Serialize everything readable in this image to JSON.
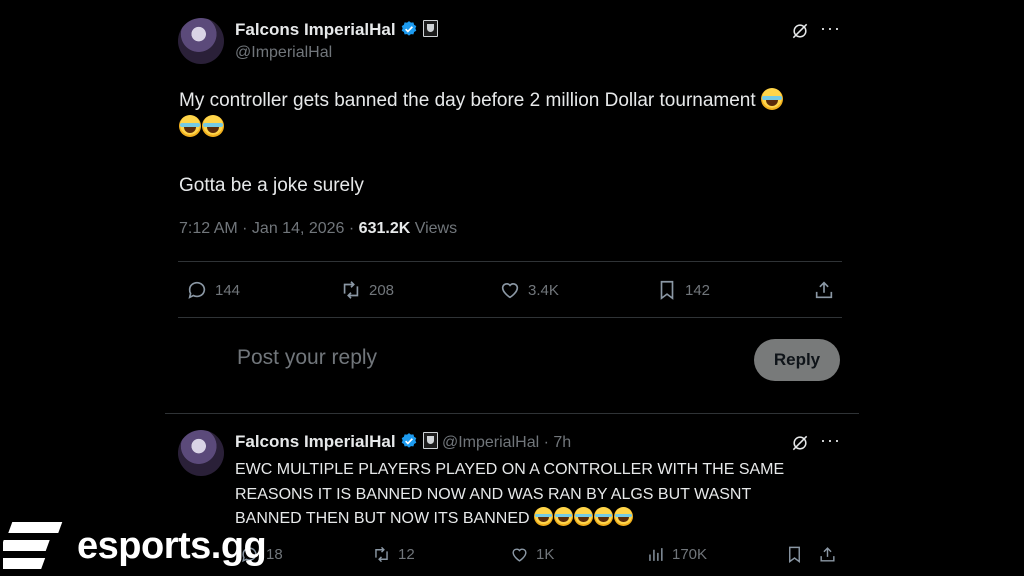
{
  "tweet": {
    "display_name": "Falcons ImperialHal",
    "handle": "@ImperialHal",
    "text_line1": "My controller gets banned the day before 2 million Dollar tournament",
    "text_line2": "Gotta be a joke surely",
    "timestamp": "7:12 AM · Jan 14, 2026 ·",
    "views_count": "631.2K",
    "views_label": "Views",
    "replies": "144",
    "retweets": "208",
    "likes": "3.4K",
    "bookmarks": "142"
  },
  "reply_box": {
    "placeholder": "Post your reply",
    "button_label": "Reply"
  },
  "reply": {
    "display_name": "Falcons ImperialHal",
    "handle": "@ImperialHal",
    "time": "· 7h",
    "text_line1": "EWC MULTIPLE PLAYERS PLAYED ON A CONTROLLER WITH THE SAME",
    "text_line2": "REASONS IT IS BANNED NOW AND WAS RAN BY ALGS BUT WASNT",
    "text_line3": "BANNED THEN BUT NOW ITS BANNED",
    "replies": "18",
    "retweets": "12",
    "likes": "1K",
    "views": "170K"
  },
  "watermark": {
    "brand": "esports.gg"
  },
  "icons": [
    "verified-badge-icon",
    "affiliate-badge-icon",
    "grok-icon",
    "more-icon",
    "reply-icon",
    "retweet-icon",
    "like-icon",
    "bookmark-icon",
    "share-icon",
    "views-icon",
    "laughing-emoji"
  ],
  "colors": {
    "background": "#000000",
    "text": "#e7e9ea",
    "muted": "#71767b",
    "verified": "#1d9bf0",
    "reply_button": "#787a7a"
  }
}
